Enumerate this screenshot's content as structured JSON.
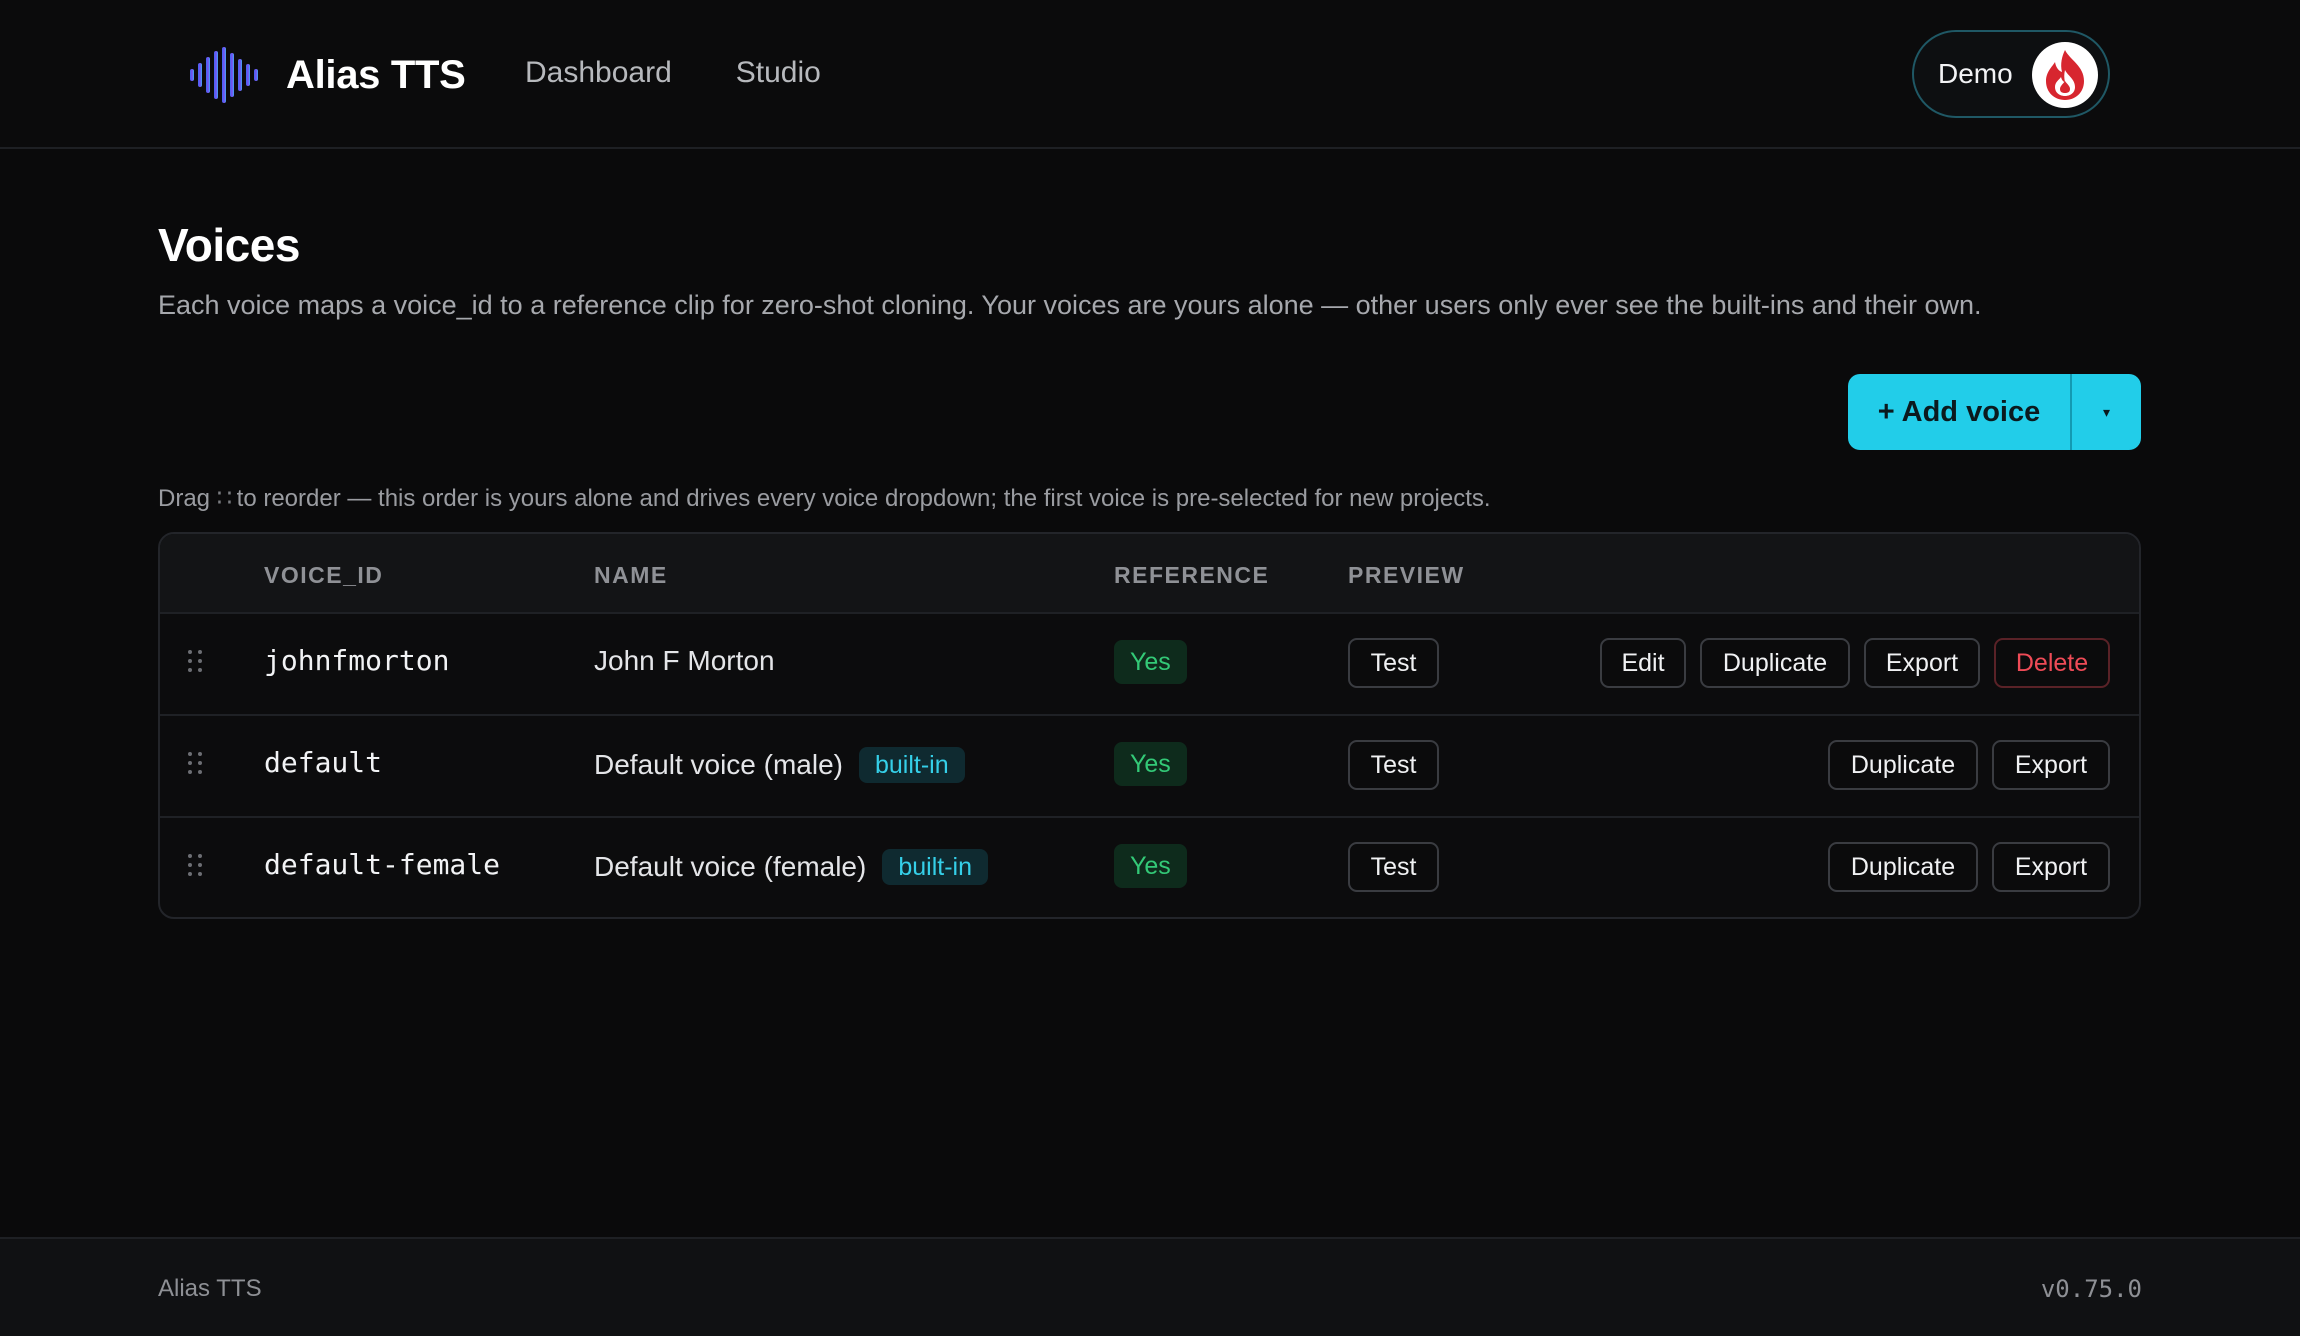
{
  "header": {
    "brand": "Alias TTS",
    "brand_icon": "waveform-icon",
    "nav": [
      {
        "label": "Dashboard"
      },
      {
        "label": "Studio"
      }
    ],
    "user": {
      "name": "Demo",
      "avatar_icon": "flame-logo-icon"
    }
  },
  "page": {
    "title": "Voices",
    "description": "Each voice maps a voice_id to a reference clip for zero-shot cloning. Your voices are yours alone — other users only ever see the built-ins and their own.",
    "add_button": "+ Add voice",
    "add_menu_caret": "▾",
    "hint_prefix": "Drag",
    "hint_grip": "∷",
    "hint_suffix": "to reorder — this order is yours alone and drives every voice dropdown; the first voice is pre-selected for new projects."
  },
  "table": {
    "columns": [
      "VOICE_ID",
      "NAME",
      "REFERENCE",
      "PREVIEW"
    ],
    "rows": [
      {
        "voice_id": "johnfmorton",
        "name": "John F Morton",
        "badge": "",
        "reference": "Yes",
        "preview": "Test",
        "actions": [
          "Edit",
          "Duplicate",
          "Export",
          "Delete"
        ]
      },
      {
        "voice_id": "default",
        "name": "Default voice (male)",
        "badge": "built-in",
        "reference": "Yes",
        "preview": "Test",
        "actions": [
          "Duplicate",
          "Export"
        ]
      },
      {
        "voice_id": "default-female",
        "name": "Default voice (female)",
        "badge": "built-in",
        "reference": "Yes",
        "preview": "Test",
        "actions": [
          "Duplicate",
          "Export"
        ]
      }
    ]
  },
  "footer": {
    "brand": "Alias TTS",
    "version": "v0.75.0"
  },
  "colors": {
    "background": "#0a0a0b",
    "accent": "#22cde9",
    "success": "#33c977",
    "danger": "#ef4b57",
    "builtin_badge": "#35cfe8"
  }
}
